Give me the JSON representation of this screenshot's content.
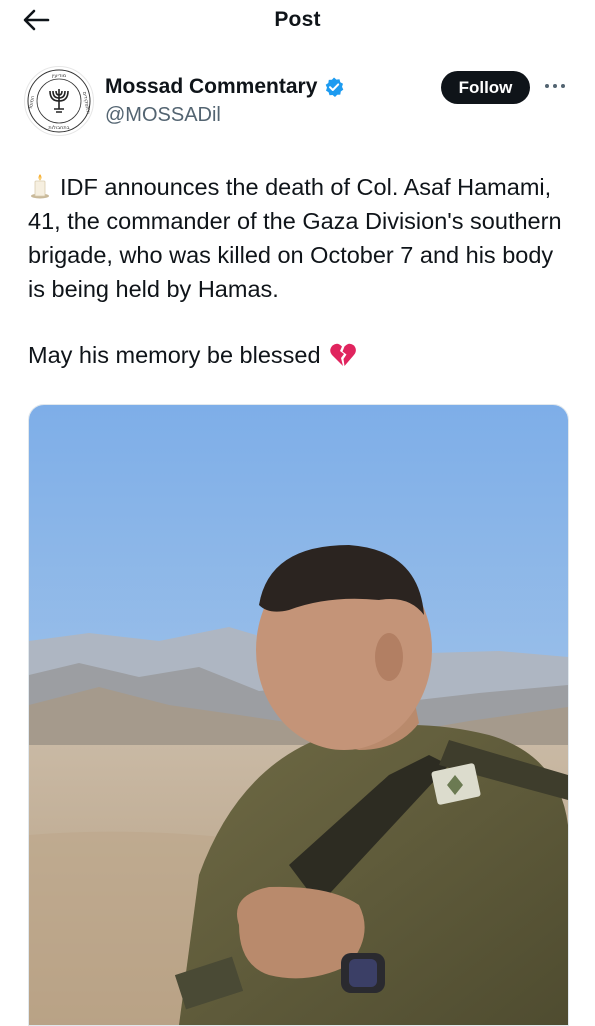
{
  "header": {
    "title": "Post",
    "back_icon": "arrow-left-icon"
  },
  "author": {
    "name": "Mossad Commentary",
    "handle": "@MOSSADil",
    "verified": true,
    "verified_color": "#1d9bf0",
    "follow_label": "Follow",
    "more_icon": "more-horizontal-icon",
    "avatar_seal_text": "הקהילה המודיעין ולתפקידים מיוחדים"
  },
  "post": {
    "text": "IDF announces the death of Col. Asaf Hamami, 41, the commander of the Gaza Division's southern brigade, who was killed on October 7 and his body is being held by Hamas.",
    "line2": "May his memory be blessed",
    "lead_emoji": "candle-icon",
    "tail_emoji": "broken-heart-icon"
  },
  "media": {
    "description_icon": "photo-soldier-desert"
  }
}
